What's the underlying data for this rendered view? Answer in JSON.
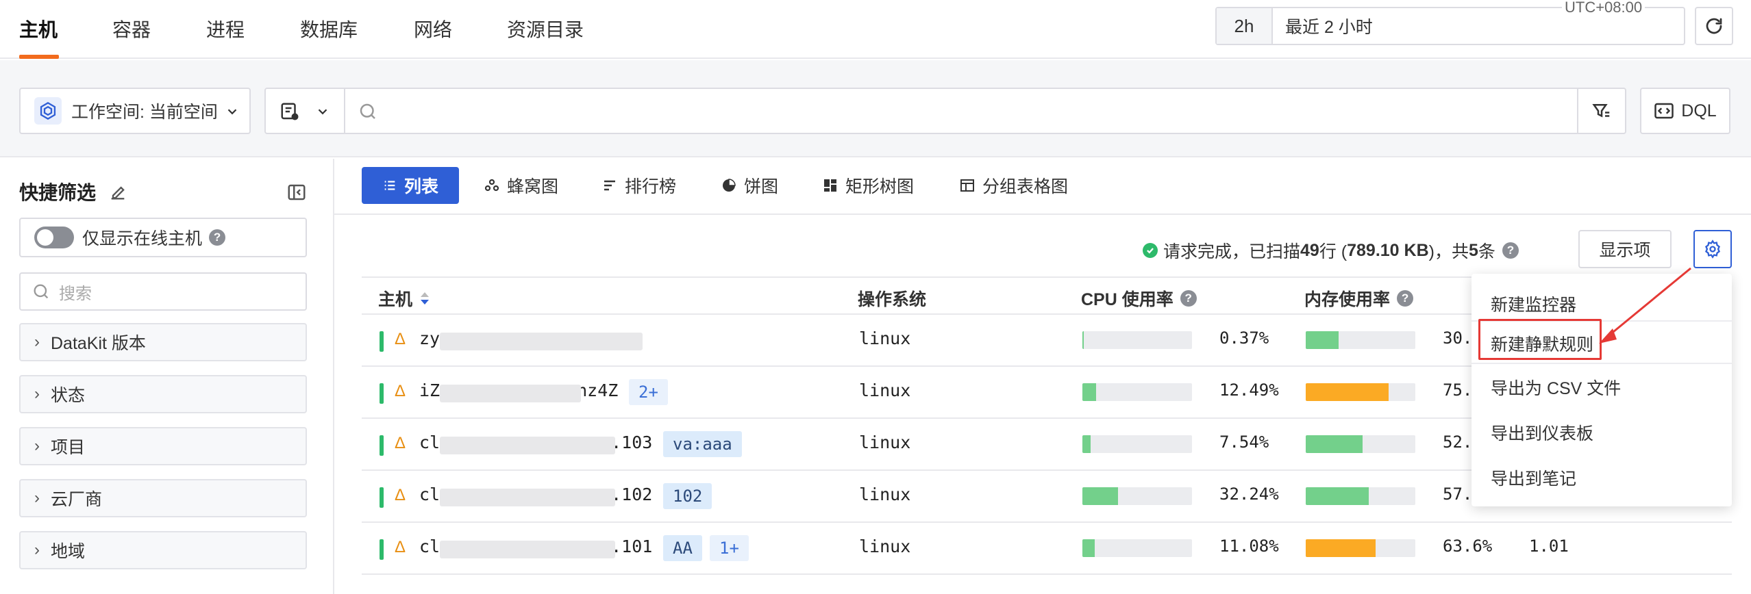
{
  "nav": {
    "tabs": [
      "主机",
      "容器",
      "进程",
      "数据库",
      "网络",
      "资源目录"
    ],
    "time_code": "2h",
    "time_label": "最近 2 小时",
    "timezone": "UTC+08:00"
  },
  "filter": {
    "workspace_label": "工作空间: 当前空间",
    "dql_label": "DQL"
  },
  "sidebar": {
    "title": "快捷筛选",
    "online_toggle_label": "仅显示在线主机",
    "search_placeholder": "搜索",
    "facets": [
      "DataKit 版本",
      "状态",
      "项目",
      "云厂商",
      "地域"
    ]
  },
  "views": [
    "列表",
    "蜂窝图",
    "排行榜",
    "饼图",
    "矩形树图",
    "分组表格图"
  ],
  "status": {
    "text_prefix": "请求完成，已扫描 ",
    "rows": "49",
    "text_mid": " 行 (",
    "size": "789.10 KB",
    "text_mid2": ")，共 ",
    "count": "5",
    "text_suffix": " 条",
    "show_columns_label": "显示项"
  },
  "table": {
    "headers": {
      "host": "主机",
      "os": "操作系统",
      "cpu": "CPU 使用率",
      "mem": "内存使用率"
    },
    "rows": [
      {
        "host_prefix": "zy",
        "host_suffix": "",
        "tags": [],
        "os": "linux",
        "cpu": 0.37,
        "cpu_text": "0.37%",
        "mem": 0.3,
        "mem_text": "30.",
        "mem_warn": false,
        "extra": ""
      },
      {
        "host_prefix": "iZ",
        "host_suffix": "nz4Z",
        "tags": [
          "2+"
        ],
        "os": "linux",
        "cpu": 12.49,
        "cpu_text": "12.49%",
        "mem": 0.755,
        "mem_text": "75.",
        "mem_warn": true,
        "extra": ""
      },
      {
        "host_prefix": "cl",
        "host_suffix": ".103",
        "tags": [
          "va:aaa"
        ],
        "os": "linux",
        "cpu": 7.54,
        "cpu_text": "7.54%",
        "mem": 0.52,
        "mem_text": "52.",
        "mem_warn": false,
        "extra": ""
      },
      {
        "host_prefix": "cl",
        "host_suffix": ".102",
        "tags": [
          "102"
        ],
        "os": "linux",
        "cpu": 32.24,
        "cpu_text": "32.24%",
        "mem": 0.575,
        "mem_text": "57.",
        "mem_warn": false,
        "extra": ""
      },
      {
        "host_prefix": "cl",
        "host_suffix": ".101",
        "tags": [
          "AA",
          "1+"
        ],
        "os": "linux",
        "cpu": 11.08,
        "cpu_text": "11.08%",
        "mem": 0.636,
        "mem_text": "63.6%",
        "mem_warn": true,
        "extra": "1.01"
      }
    ]
  },
  "menu": {
    "items": [
      "新建监控器",
      "新建静默规则",
      "导出为 CSV 文件",
      "导出到仪表板",
      "导出到笔记"
    ]
  },
  "colors": {
    "accent": "#2f5fd6",
    "nav_active": "#f26b1d",
    "ok": "#2dba6a",
    "bar_ok": "#73d08b",
    "bar_warn": "#fbaa24",
    "highlight": "#e53935"
  }
}
